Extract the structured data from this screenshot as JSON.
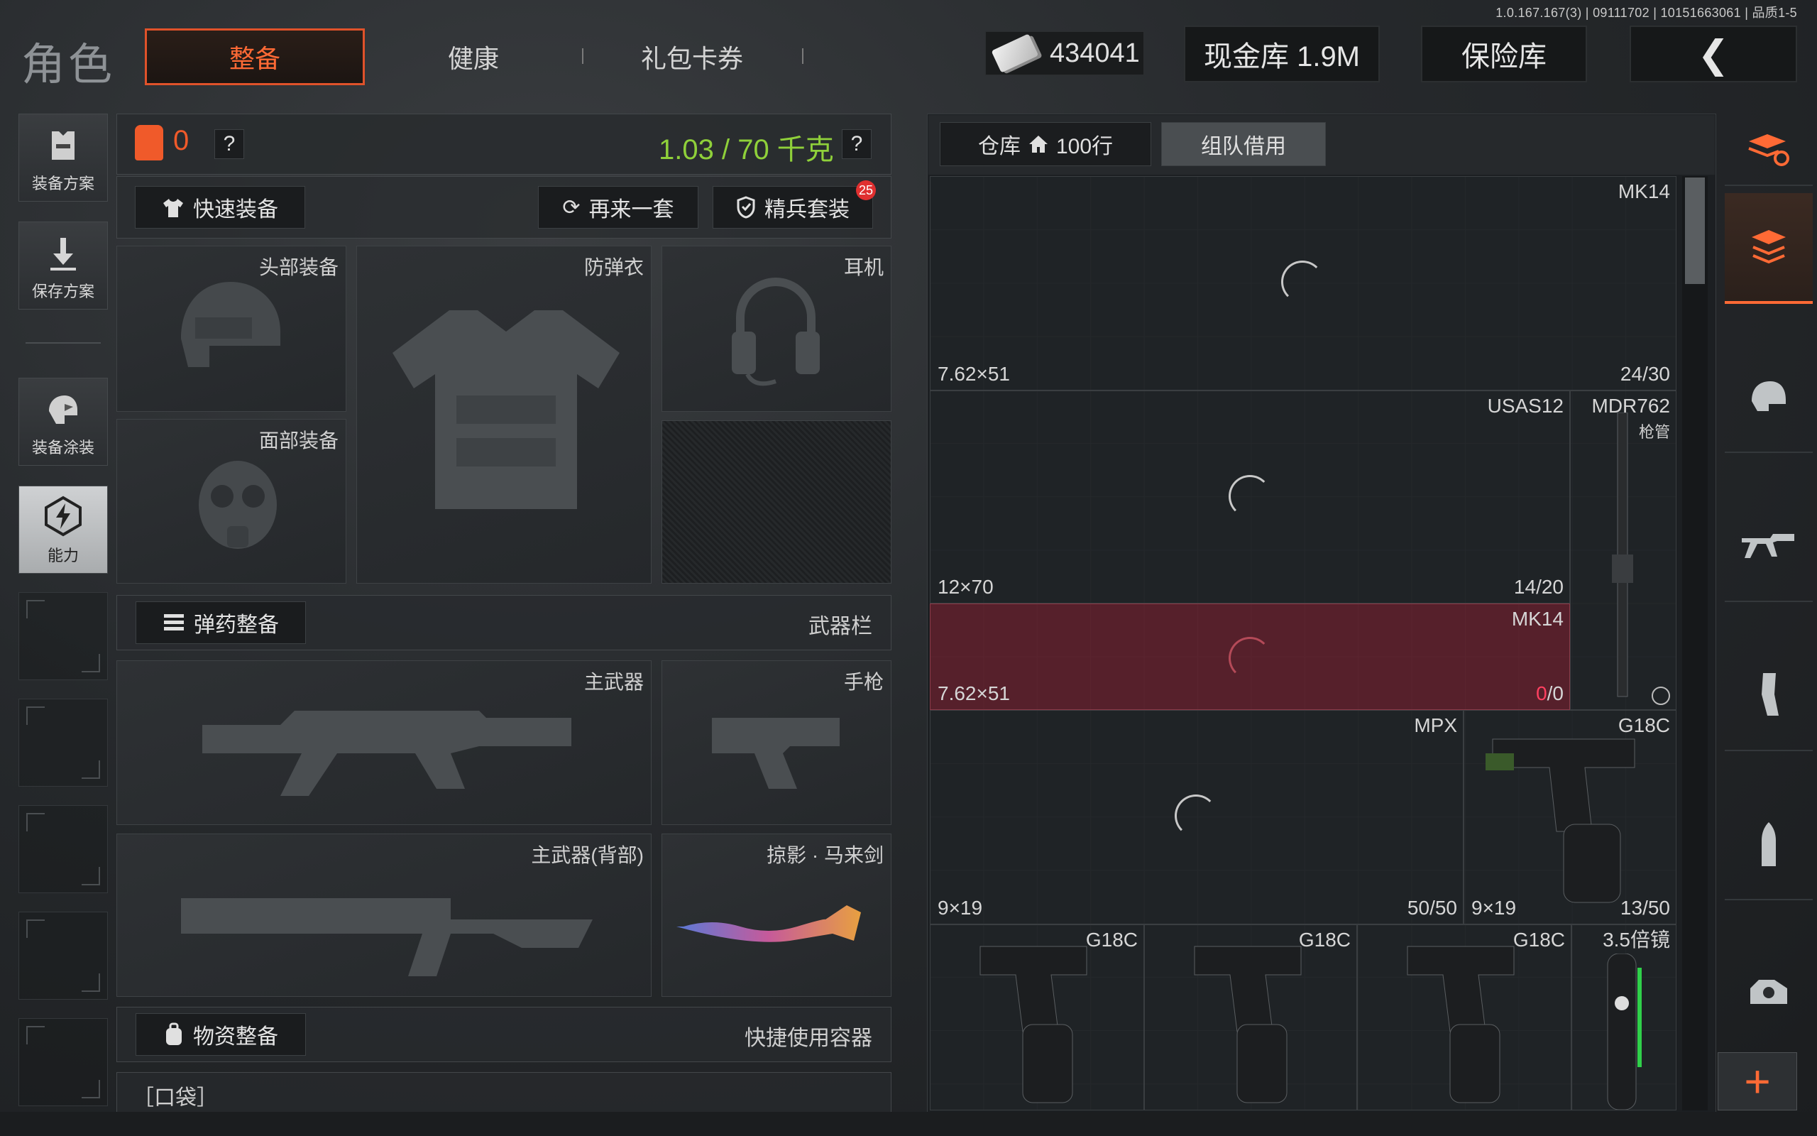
{
  "version": "1.0.167.167(3) | 09111702 | 10151663061 | 品质1-5",
  "header": {
    "title": "角色",
    "tabs": [
      "整备",
      "健康",
      "礼包卡券"
    ],
    "cash_amount": "434041",
    "cash_vault": "现金库 1.9M",
    "safe_box": "保险库",
    "back_glyph": "❮"
  },
  "sidebar": {
    "equip_plan": "装备方案",
    "save_plan": "保存方案",
    "equip_skin": "装备涂装",
    "ability": "能力"
  },
  "loadout": {
    "armor_count": "0",
    "help_glyph": "?",
    "weight": "1.03 / 70 千克",
    "quick_equip": "快速装备",
    "another_set": "再来一套",
    "elite_set": "精兵套装",
    "elite_badge": "25",
    "slots": {
      "head": "头部装备",
      "vest": "防弹衣",
      "headset": "耳机",
      "face": "面部装备",
      "primary": "主武器",
      "pistol": "手枪",
      "primary_back": "主武器(背部)",
      "melee": "掠影 · 马来剑"
    },
    "ammo_section": "弹药整备",
    "weapon_bar": "武器栏",
    "supply_section": "物资整备",
    "quick_container": "快捷使用容器",
    "pocket": "［口袋］"
  },
  "inventory": {
    "warehouse_tab": "仓库",
    "warehouse_rows": "100行",
    "team_borrow_tab": "组队借用",
    "items": [
      {
        "name": "MK14",
        "caliber": "7.62×51",
        "count": "24/30"
      },
      {
        "name": "USAS12",
        "caliber": "12×70",
        "count": "14/20"
      },
      {
        "name": "MDR762",
        "sub": "枪管"
      },
      {
        "name": "MK14",
        "caliber": "7.62×51",
        "count_a": "0",
        "count_b": "/0"
      },
      {
        "name": "MPX",
        "caliber": "9×19",
        "count": "50/50"
      },
      {
        "name": "G18C",
        "caliber": "9×19",
        "count": "13/50"
      },
      {
        "name": "G18C"
      },
      {
        "name": "G18C"
      },
      {
        "name": "G18C"
      },
      {
        "name": "3.5倍镜"
      }
    ]
  },
  "colors": {
    "accent": "#ff6a35",
    "weight_ok": "#8fd03a",
    "danger": "#e03030"
  }
}
